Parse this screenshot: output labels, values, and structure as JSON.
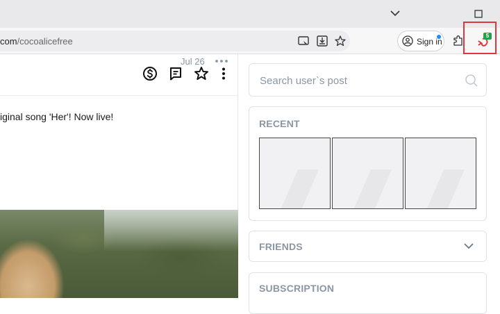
{
  "browser": {
    "url_domain": "com",
    "url_path": "/cocoalicefree",
    "signin_label": "Sign in",
    "extension_badge": "5",
    "icons": [
      "chevron-down-icon",
      "maximize-icon",
      "cast-icon",
      "download-icon",
      "star-icon",
      "account-icon",
      "puzzle-icon",
      "extension-icon"
    ]
  },
  "header_icons": [
    "dollar-icon",
    "message-icon",
    "star-icon",
    "more-vertical-icon"
  ],
  "post": {
    "date": "Jul 26",
    "text": "iginal song 'Her'! Now live!"
  },
  "sidebar": {
    "search_placeholder": "Search user`s post",
    "recent_title": "RECENT",
    "friends_title": "FRIENDS",
    "subscription_title": "SUBSCRIPTION"
  },
  "colors": {
    "muted_text": "#8a96a3",
    "card_border": "#dfe3e8",
    "highlight_box": "#e0363b",
    "badge_green": "#23a04b"
  }
}
